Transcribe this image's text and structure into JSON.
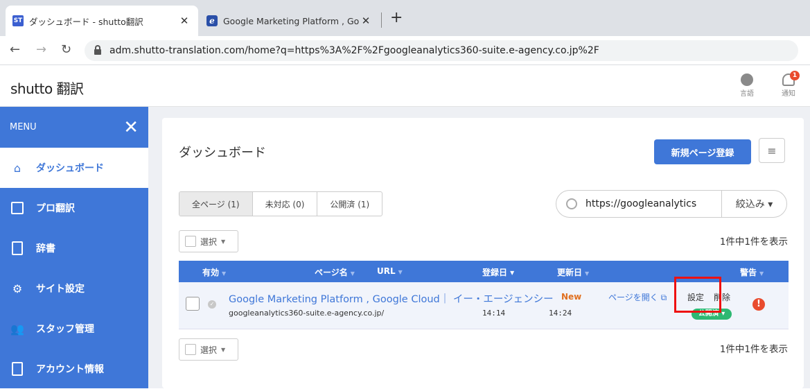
{
  "browser": {
    "tabs": [
      {
        "favicon": "ST",
        "title": "ダッシュボード - shutto翻訳"
      },
      {
        "favicon": "e",
        "title": "Google Marketing Platform , Goo"
      }
    ],
    "url": "adm.shutto-translation.com/home?q=https%3A%2F%2Fgoogleanalytics360-suite.e-agency.co.jp%2F"
  },
  "app": {
    "logo": "shutto 翻訳",
    "header_icons": [
      {
        "label": "言語",
        "icon": "globe-icon"
      },
      {
        "label": "通知",
        "icon": "bell-icon",
        "badge": "1"
      }
    ]
  },
  "sidebar": {
    "menu_label": "MENU",
    "items": [
      {
        "label": "ダッシュボード",
        "icon": "home-icon"
      },
      {
        "label": "プロ翻訳",
        "icon": "calendar-icon"
      },
      {
        "label": "辞書",
        "icon": "book-icon"
      },
      {
        "label": "サイト設定",
        "icon": "gear-icon"
      },
      {
        "label": "スタッフ管理",
        "icon": "users-icon"
      },
      {
        "label": "アカウント情報",
        "icon": "document-icon"
      }
    ]
  },
  "main": {
    "title": "ダッシュボード",
    "new_page_button": "新規ページ登録",
    "filters": [
      "全ページ (1)",
      "未対応 (0)",
      "公開済 (1)"
    ],
    "search_value": "https://googleanalytics",
    "narrow_label": "絞込み ▾",
    "select_label": "選択",
    "count_text": "1件中1件を表示",
    "columns": [
      "有効",
      "ページ名",
      "URL",
      "登録日 ▾",
      "更新日",
      "警告"
    ],
    "rows": [
      {
        "title": "Google Marketing Platform , Google Cloud｜ イー・エージェンシー",
        "new_badge": "New",
        "url": "googleanalytics360-suite.e-agency.co.jp/",
        "registered": "14:14",
        "updated": "14:24",
        "open_page": "ページを開く",
        "settings": "設定",
        "delete": "削除",
        "status": "公開済 ▾",
        "warning": "!"
      }
    ]
  }
}
